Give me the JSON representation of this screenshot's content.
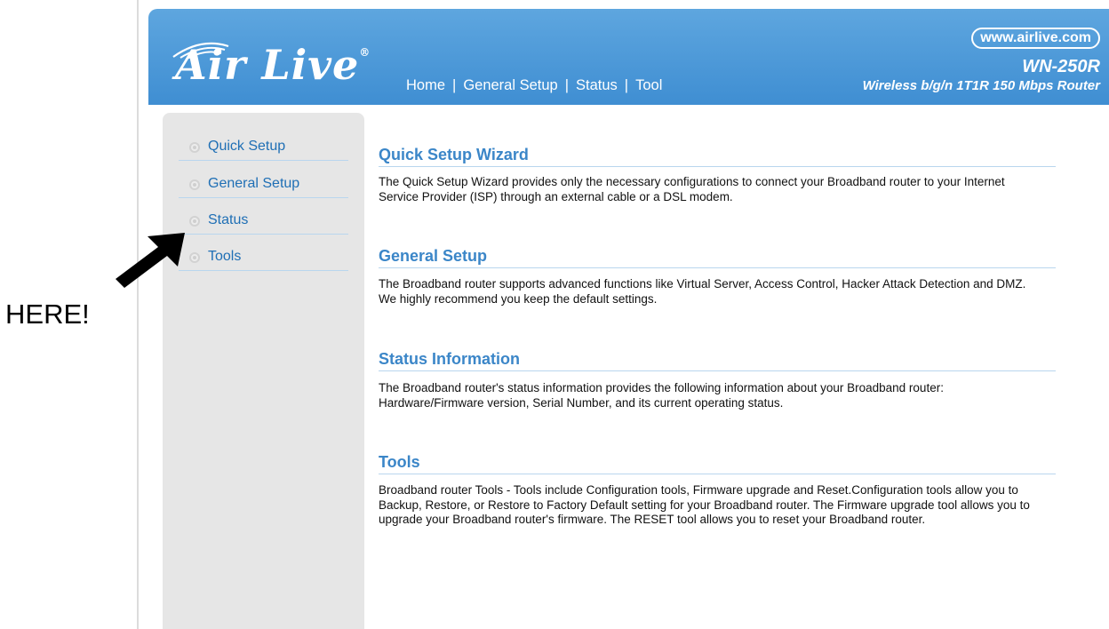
{
  "header": {
    "logo_text": "Air Live",
    "logo_mark": "®",
    "nav": [
      "Home",
      "General Setup",
      "Status",
      "Tool"
    ],
    "nav_separator": "|",
    "url": "www.airlive.com",
    "model": "WN-250R",
    "subtitle": "Wireless b/g/n 1T1R 150 Mbps Router",
    "accent_color": "#4a97d8"
  },
  "sidebar": {
    "items": [
      {
        "label": "Quick Setup",
        "icon": "radio-bullet-icon"
      },
      {
        "label": "General Setup",
        "icon": "radio-bullet-icon"
      },
      {
        "label": "Status",
        "icon": "radio-bullet-icon"
      },
      {
        "label": "Tools",
        "icon": "radio-bullet-icon"
      }
    ]
  },
  "main": {
    "sections": [
      {
        "title": "Quick Setup Wizard",
        "text": "The Quick Setup Wizard provides only the necessary configurations to connect your Broadband router to your Internet Service Provider (ISP) through an external cable or a DSL modem."
      },
      {
        "title": "General Setup",
        "text": "The Broadband router supports advanced functions like Virtual Server, Access Control, Hacker Attack Detection and DMZ. We highly recommend you keep the default settings."
      },
      {
        "title": "Status Information",
        "text": "The Broadband router's status information provides the following information about your Broadband router: Hardware/Firmware version, Serial Number, and its current operating status."
      },
      {
        "title": "Tools",
        "text": "Broadband router Tools - Tools include Configuration tools, Firmware upgrade and Reset.Configuration tools allow you to Backup, Restore, or Restore to Factory Default setting for your Broadband router. The Firmware upgrade tool allows you to upgrade your Broadband router's firmware. The RESET tool allows you to reset your Broadband router."
      }
    ]
  },
  "annotation": {
    "label": "HERE!",
    "arrow_icon": "arrow-pointer-icon"
  }
}
